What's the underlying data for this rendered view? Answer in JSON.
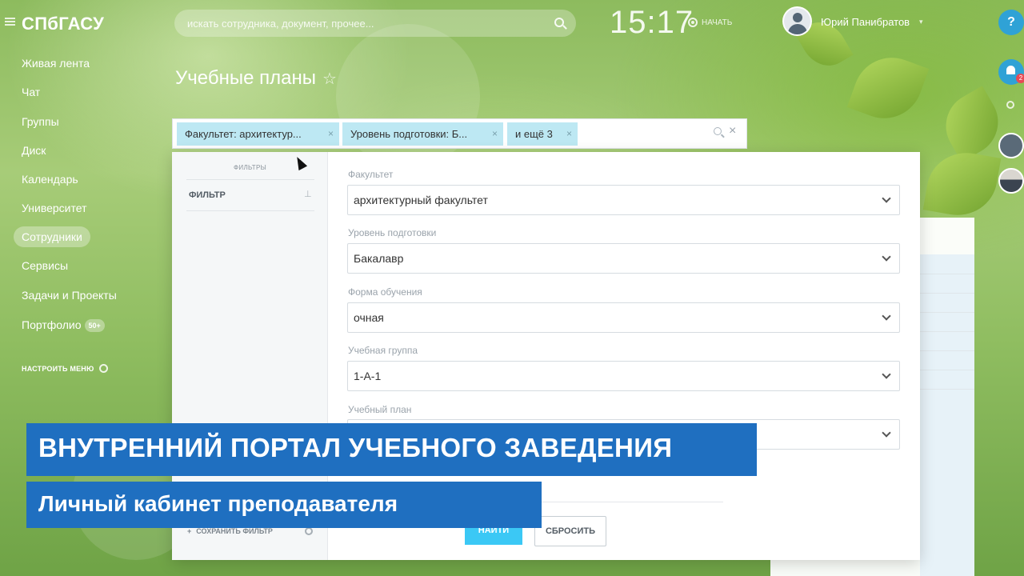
{
  "app": {
    "logo": "СПбГАСУ",
    "search_placeholder": "искать сотрудника, документ, прочее...",
    "clock": "15:17",
    "start_label": "НАЧАТЬ",
    "user_name": "Юрий Панибратов",
    "help_label": "?",
    "notifications_count": "2"
  },
  "sidebar": {
    "items": [
      {
        "label": "Живая лента"
      },
      {
        "label": "Чат"
      },
      {
        "label": "Группы"
      },
      {
        "label": "Диск"
      },
      {
        "label": "Календарь"
      },
      {
        "label": "Университет"
      },
      {
        "label": "Сотрудники",
        "active": true
      },
      {
        "label": "Сервисы"
      },
      {
        "label": "Задачи и Проекты"
      },
      {
        "label": "Портфолио",
        "counter": "50+"
      }
    ],
    "configure_label": "НАСТРОИТЬ МЕНЮ"
  },
  "page": {
    "title": "Учебные планы"
  },
  "filter_bar": {
    "chips": [
      {
        "label": "Факультет: архитектур..."
      },
      {
        "label": "Уровень подготовки: Б..."
      },
      {
        "label": "и ещё 3"
      }
    ]
  },
  "filter_popup": {
    "left_caption": "ФИЛЬТРЫ",
    "filter_item": "ФИЛЬТР",
    "save_filter_label": "СОХРАНИТЬ ФИЛЬТР",
    "fields": [
      {
        "label": "Факультет",
        "value": "архитектурный факультет"
      },
      {
        "label": "Уровень подготовки",
        "value": "Бакалавр"
      },
      {
        "label": "Форма обучения",
        "value": "очная"
      },
      {
        "label": "Учебная группа",
        "value": "1-А-1"
      },
      {
        "label": "Учебный план",
        "value": ""
      }
    ],
    "find_button": "НАЙТИ",
    "reset_button": "СБРОСИТЬ"
  },
  "captions": {
    "headline": "ВНУТРЕННИЙ ПОРТАЛ УЧЕБНОГО ЗАВЕДЕНИЯ",
    "subline": "Личный кабинет преподавателя"
  },
  "colors": {
    "accent_blue": "#3bc8f5",
    "caption_blue": "#1f6fc0",
    "chip_bg": "#bde8f3"
  }
}
